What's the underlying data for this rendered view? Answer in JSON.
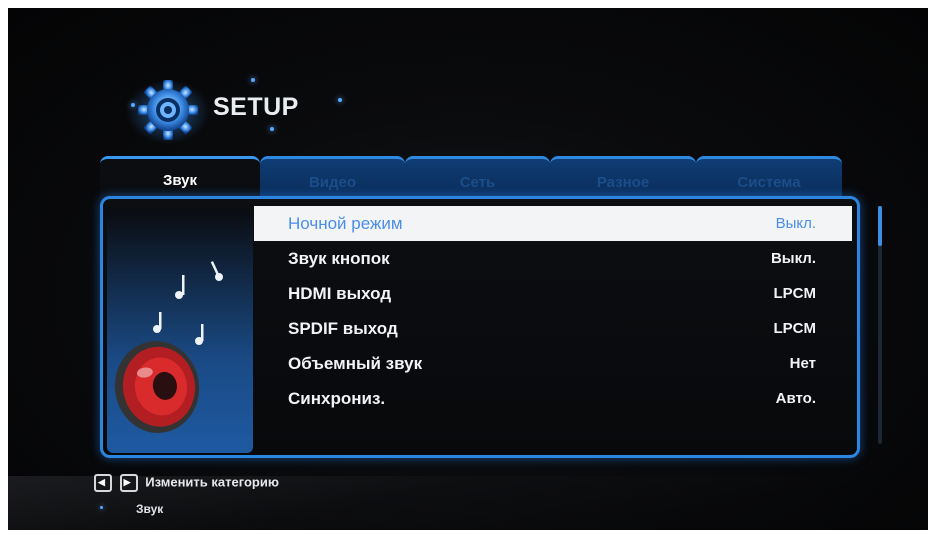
{
  "header": {
    "title": "SETUP",
    "logo_icon": "gear-icon"
  },
  "tabs": [
    {
      "label": "Звук",
      "active": true
    },
    {
      "label": "Видео",
      "active": false
    },
    {
      "label": "Сеть",
      "active": false
    },
    {
      "label": "Разное",
      "active": false
    },
    {
      "label": "Система",
      "active": false
    }
  ],
  "settings": [
    {
      "label": "Ночной режим",
      "value": "Выкл.",
      "selected": true
    },
    {
      "label": "Звук кнопок",
      "value": "Выкл.",
      "selected": false
    },
    {
      "label": "HDMI выход",
      "value": "LPCM",
      "selected": false
    },
    {
      "label": "SPDIF выход",
      "value": "LPCM",
      "selected": false
    },
    {
      "label": "Объемный звук",
      "value": "Нет",
      "selected": false
    },
    {
      "label": "Синхрониз.",
      "value": "Авто.",
      "selected": false
    }
  ],
  "footer": {
    "hint": "Изменить категорию",
    "category": "Звук"
  },
  "colors": {
    "accent": "#2c86e0",
    "selection_text": "#4b8ee8",
    "background": "#050608"
  }
}
